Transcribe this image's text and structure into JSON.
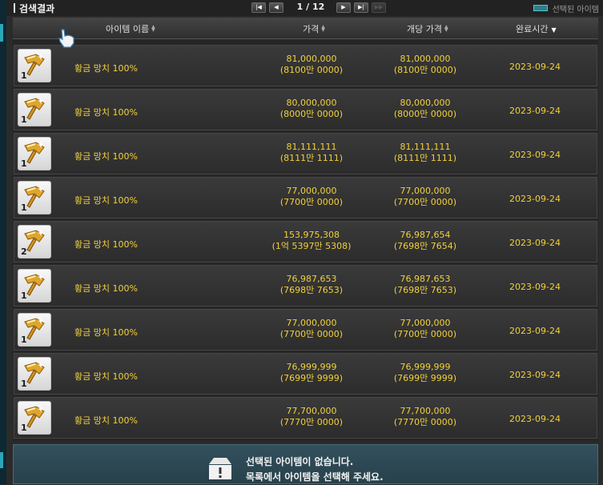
{
  "header": {
    "title": "검색결과",
    "pager": {
      "text": "1 / 12",
      "first_icon": "first-page-icon",
      "prev_icon": "prev-page-icon",
      "next_icon": "next-page-icon",
      "last_icon": "last-page-icon",
      "extra_icon": "skip-icon"
    },
    "legend_label": "선택된 아이템",
    "legend_color": "#2a7f8a"
  },
  "columns": {
    "name": "아이템 이름",
    "price": "가격",
    "unit_price": "개당 가격",
    "completed": "완료시간"
  },
  "rows": [
    {
      "qty": "1",
      "name": "황금 망치 100%",
      "price": "81,000,000",
      "price_kr": "(8100만 0000)",
      "unit": "81,000,000",
      "unit_kr": "(8100만 0000)",
      "date": "2023-09-24"
    },
    {
      "qty": "1",
      "name": "황금 망치 100%",
      "price": "80,000,000",
      "price_kr": "(8000만 0000)",
      "unit": "80,000,000",
      "unit_kr": "(8000만 0000)",
      "date": "2023-09-24"
    },
    {
      "qty": "1",
      "name": "황금 망치 100%",
      "price": "81,111,111",
      "price_kr": "(8111만 1111)",
      "unit": "81,111,111",
      "unit_kr": "(8111만 1111)",
      "date": "2023-09-24"
    },
    {
      "qty": "1",
      "name": "황금 망치 100%",
      "price": "77,000,000",
      "price_kr": "(7700만 0000)",
      "unit": "77,000,000",
      "unit_kr": "(7700만 0000)",
      "date": "2023-09-24"
    },
    {
      "qty": "2",
      "name": "황금 망치 100%",
      "price": "153,975,308",
      "price_kr": "(1억 5397만 5308)",
      "unit": "76,987,654",
      "unit_kr": "(7698만 7654)",
      "date": "2023-09-24"
    },
    {
      "qty": "1",
      "name": "황금 망치 100%",
      "price": "76,987,653",
      "price_kr": "(7698만 7653)",
      "unit": "76,987,653",
      "unit_kr": "(7698만 7653)",
      "date": "2023-09-24"
    },
    {
      "qty": "1",
      "name": "황금 망치 100%",
      "price": "77,000,000",
      "price_kr": "(7700만 0000)",
      "unit": "77,000,000",
      "unit_kr": "(7700만 0000)",
      "date": "2023-09-24"
    },
    {
      "qty": "1",
      "name": "황금 망치 100%",
      "price": "76,999,999",
      "price_kr": "(7699만 9999)",
      "unit": "76,999,999",
      "unit_kr": "(7699만 9999)",
      "date": "2023-09-24"
    },
    {
      "qty": "1",
      "name": "황금 망치 100%",
      "price": "77,700,000",
      "price_kr": "(7770만 0000)",
      "unit": "77,700,000",
      "unit_kr": "(7770만 0000)",
      "date": "2023-09-24"
    }
  ],
  "detail": {
    "line1": "선택된 아이템이 없습니다.",
    "line2": "목록에서 아이템을 선택해 주세요.",
    "icon": "empty-box-icon"
  },
  "colors": {
    "accent_text": "#f2d03a",
    "detail_bg": "#32505d"
  }
}
